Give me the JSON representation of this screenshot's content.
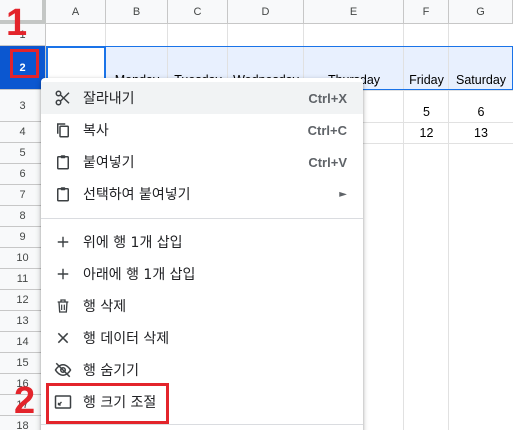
{
  "columns": [
    "A",
    "B",
    "C",
    "D",
    "E",
    "F",
    "G"
  ],
  "rows": [
    "1",
    "2",
    "3",
    "4",
    "5",
    "6",
    "7",
    "8",
    "9",
    "10",
    "11",
    "12",
    "13",
    "14",
    "15",
    "16",
    "17",
    "18"
  ],
  "selected_row": "2",
  "cells": {
    "row2": [
      "Monday",
      "Tuesday",
      "Wednesday",
      "Thursday",
      "Friday",
      "Saturday"
    ],
    "row3": [
      "5",
      "6"
    ],
    "row4": [
      "12",
      "13"
    ]
  },
  "annotations": {
    "step1": "1",
    "step2": "2"
  },
  "menu": {
    "items": [
      {
        "icon": "scissors-icon",
        "label": "잘라내기",
        "shortcut": "Ctrl+X"
      },
      {
        "icon": "copy-icon",
        "label": "복사",
        "shortcut": "Ctrl+C"
      },
      {
        "icon": "clipboard-icon",
        "label": "붙여넣기",
        "shortcut": "Ctrl+V"
      },
      {
        "icon": "clipboard-icon",
        "label": "선택하여 붙여넣기",
        "submenu_arrow": "►"
      },
      {
        "icon": "plus-icon",
        "label": "위에 행 1개 삽입"
      },
      {
        "icon": "plus-icon",
        "label": "아래에 행 1개 삽입"
      },
      {
        "icon": "trash-icon",
        "label": "행 삭제"
      },
      {
        "icon": "close-icon",
        "label": "행 데이터 삭제"
      },
      {
        "icon": "eye-off-icon",
        "label": "행 숨기기"
      },
      {
        "icon": "resize-icon",
        "label": "행 크기 조절"
      }
    ]
  },
  "colors": {
    "selection": "#0b57d0",
    "highlight": "#e8f0fe",
    "annotation": "#e3242b"
  }
}
